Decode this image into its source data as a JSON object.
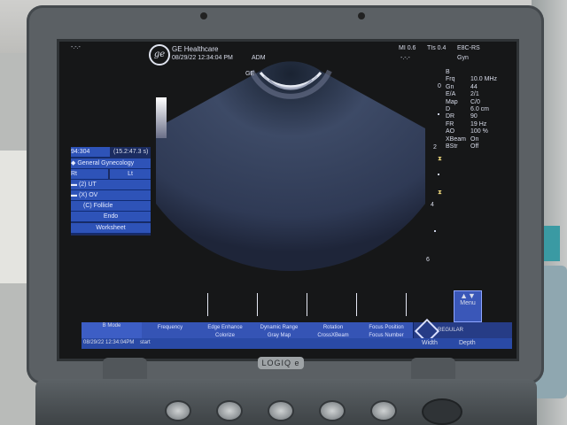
{
  "header": {
    "brand": "GE Healthcare",
    "datetime": "08/29/22 12:34:04 PM",
    "operator": "ADM",
    "mi": "MI 0.6",
    "tis": "TIs 0.4",
    "probe": "E8C-RS",
    "preset": "Gyn",
    "dashes_left": "-.-.-",
    "dashes_right": "-.-.-"
  },
  "params": [
    {
      "label": "B",
      "value": ""
    },
    {
      "label": "Frq",
      "value": "10.0 MHz"
    },
    {
      "label": "Gn",
      "value": "44"
    },
    {
      "label": "E/A",
      "value": "2/1"
    },
    {
      "label": "Map",
      "value": "C/0"
    },
    {
      "label": "D",
      "value": "6.0 cm"
    },
    {
      "label": "DR",
      "value": "90"
    },
    {
      "label": "FR",
      "value": "19 Hz"
    },
    {
      "label": "AO",
      "value": "100 %"
    },
    {
      "label": "XBeam",
      "value": "On"
    },
    {
      "label": "BStr",
      "value": "Off"
    }
  ],
  "depth_scale": {
    "zero": "0",
    "mark2": "2",
    "mark4": "4",
    "mark6": "6"
  },
  "orientation_label": "GE",
  "sidebar": {
    "counter": "94:304",
    "time": "(15.2:47.3 s)",
    "exam": "General Gynecology",
    "rt": "Rt",
    "lt": "Lt",
    "items": [
      {
        "label": "(2)  UT"
      },
      {
        "label": "(X)  OV"
      },
      {
        "label": "(C)  Follicle"
      },
      {
        "label": "Endo"
      },
      {
        "label": "Worksheet"
      }
    ]
  },
  "bottom_bar": {
    "mode": "B\nMode",
    "row1": [
      "Frequency",
      "Edge Enhance",
      "Dynamic Range",
      "Rotation",
      "Focus Position"
    ],
    "row2": [
      "",
      "Colorize",
      "Gray Map",
      "CrossXBeam",
      "Focus Number"
    ],
    "regular": "REGULAR",
    "status_left": "08/29/22 12:34:04PM",
    "start": "start",
    "width": "Width",
    "depth": "Depth",
    "menu": "Menu"
  },
  "logo_plate": "LOGIQ e",
  "colors": {
    "screen_bg": "#161718",
    "button_blue": "#2e53b8",
    "bar_blue": "#263c86",
    "text": "#d8dcea"
  }
}
